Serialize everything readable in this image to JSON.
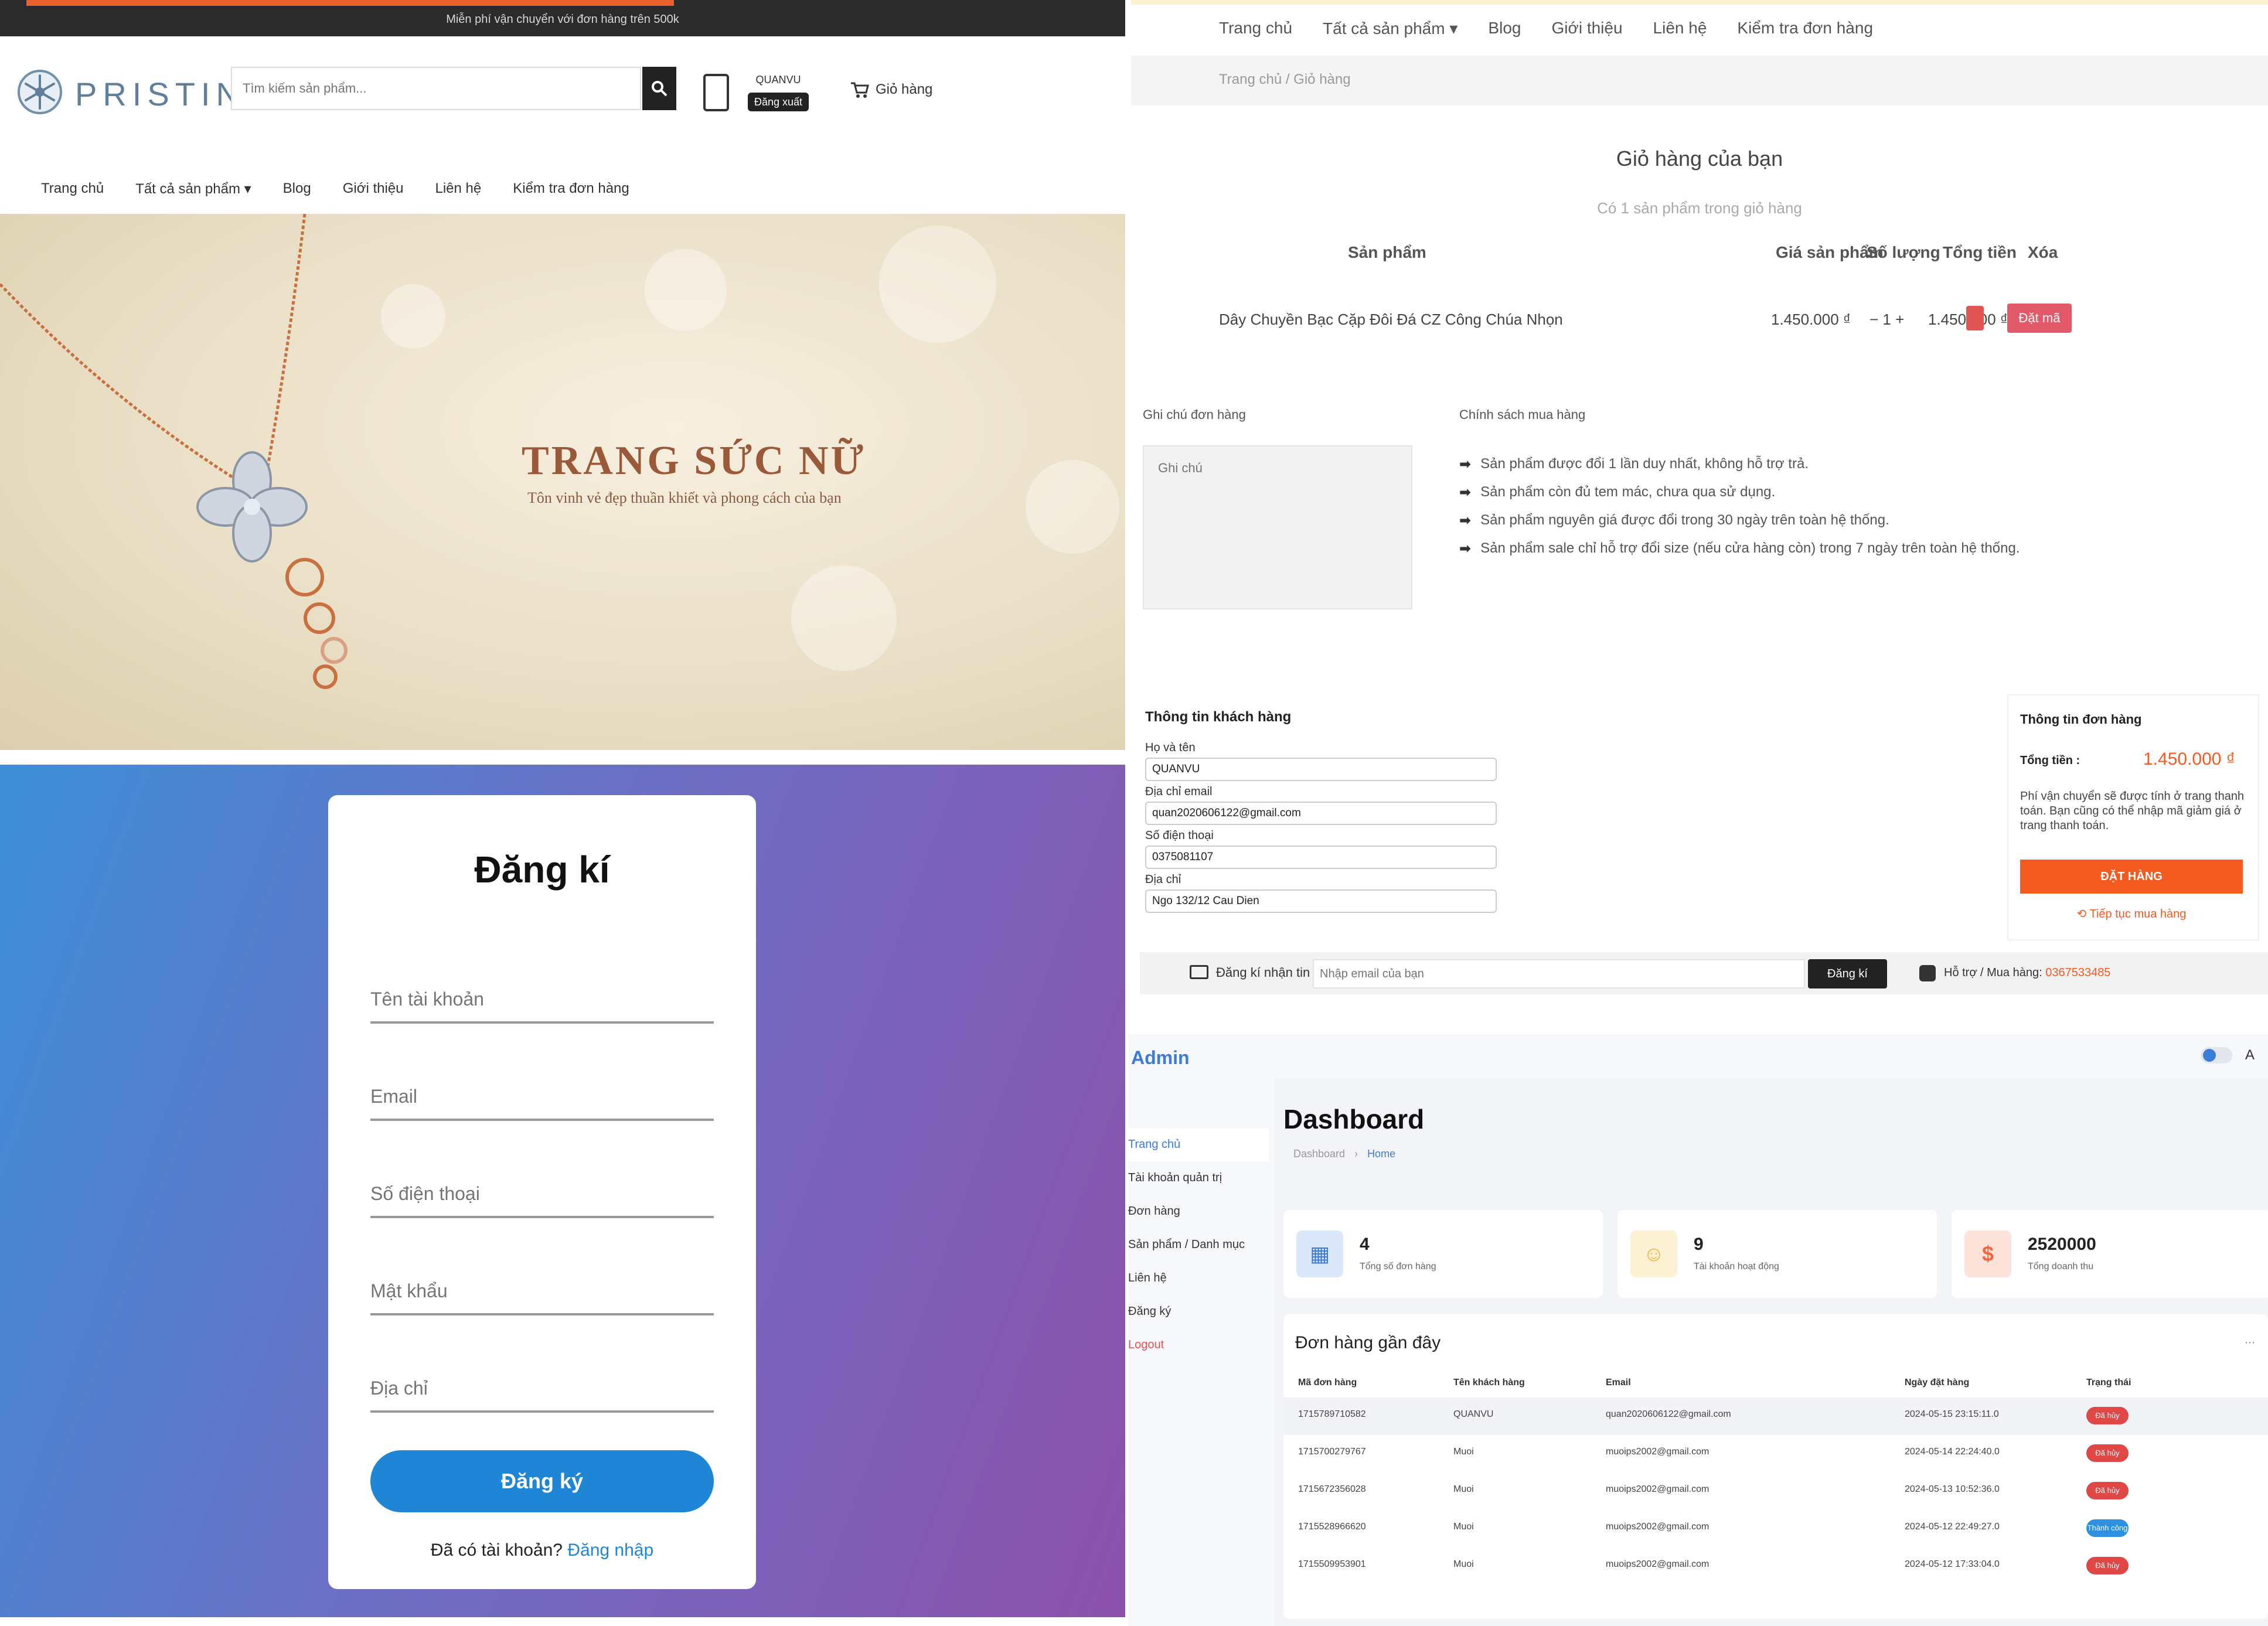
{
  "home": {
    "topbar_text": "Miễn phí vận chuyển với đơn hàng trên 500k",
    "brand": "PRISTINE",
    "search_placeholder": "Tìm kiếm sản phẩm...",
    "user_name": "QUANVU",
    "logout_label": "Đăng xuất",
    "cart_label": "Giỏ hàng",
    "nav": [
      "Trang chủ",
      "Tất cả sản phẩm ▾",
      "Blog",
      "Giới thiệu",
      "Liên hệ",
      "Kiểm tra đơn hàng"
    ],
    "hero_title": "TRANG SỨC NỮ",
    "hero_subtitle": "Tôn vinh vẻ đẹp thuần khiết và phong cách của bạn"
  },
  "register": {
    "title": "Đăng kí",
    "fields": [
      "Tên tài khoản",
      "Email",
      "Số điện thoại",
      "Mật khẩu",
      "Địa chỉ"
    ],
    "submit_label": "Đăng ký",
    "have_account": "Đã có tài khoản?",
    "login_link": "Đăng nhập"
  },
  "cart": {
    "nav": [
      "Trang chủ",
      "Tất cả sản phẩm ▾",
      "Blog",
      "Giới thiệu",
      "Liên hệ",
      "Kiểm tra đơn hàng"
    ],
    "breadcrumb": "Trang chủ / Giỏ hàng",
    "title": "Giỏ hàng của bạn",
    "count_text": "Có 1 sản phẩm trong giỏ hàng",
    "headers": [
      "Sản phẩm",
      "Giá sản phẩm",
      "Số lượng",
      "Tổng tiền",
      "Xóa"
    ],
    "item": {
      "name": "Dây Chuyền Bạc Cặp Đôi Đá CZ Công Chúa Nhọn",
      "price": "1.450.000 ₫",
      "qty": "−  1  +",
      "total": "1.450.000 ₫",
      "status": "Đặt mã"
    },
    "note_label": "Ghi chú đơn hàng",
    "note_placeholder": "Ghi chú",
    "policy_title": "Chính sách mua hàng",
    "policies": [
      "Sản phẩm được đổi 1 lần duy nhất, không hỗ trợ trả.",
      "Sản phẩm còn đủ tem mác, chưa qua sử dụng.",
      "Sản phẩm nguyên giá được đổi trong 30 ngày trên toàn hệ thống.",
      "Sản phẩm sale chỉ hỗ trợ đổi size (nếu cửa hàng còn) trong 7 ngày trên toàn hệ thống."
    ],
    "customer": {
      "title": "Thông tin khách hàng",
      "name_label": "Họ và tên",
      "name_value": "QUANVU",
      "email_label": "Địa chỉ email",
      "email_value": "quan2020606122@gmail.com",
      "phone_label": "Số điện thoại",
      "phone_value": "0375081107",
      "address_label": "Địa chỉ",
      "address_value": "Ngo 132/12 Cau Dien"
    },
    "order": {
      "title": "Thông tin đơn hàng",
      "total_label": "Tổng tiền :",
      "total_value": "1.450.000 ₫",
      "note": "Phí vận chuyển sẽ được tính ở trang thanh toán. Bạn cũng có thể nhập mã giảm giá ở trang thanh toán.",
      "order_button": "ĐẶT HÀNG",
      "continue_link": "⟲ Tiếp tục mua hàng"
    },
    "newsletter": {
      "label": "Đăng kí nhận tin",
      "placeholder": "Nhập email của bạn",
      "button": "Đăng kí",
      "support_label": "Hỗ trợ / Mua hàng:",
      "support_phone": "0367533485"
    }
  },
  "admin": {
    "brand": "Admin",
    "user_initial": "A",
    "sidebar": [
      "Trang chủ",
      "Tài khoản quản trị",
      "Đơn hàng",
      "Sản phẩm / Danh mục",
      "Liên hệ",
      "Đăng ký",
      "Logout"
    ],
    "title": "Dashboard",
    "breadcrumb": [
      "Dashboard",
      "›",
      "Home"
    ],
    "stats": [
      {
        "value": "4",
        "label": "Tổng số đơn hàng",
        "icon": "calendar-check-icon",
        "color": "#3d7bd8",
        "bg": "#dbe8fa"
      },
      {
        "value": "9",
        "label": "Tài khoản hoạt động",
        "icon": "users-icon",
        "color": "#f0b43a",
        "bg": "#fdf1d3"
      },
      {
        "value": "2520000",
        "label": "Tổng doanh thu",
        "icon": "dollar-icon",
        "color": "#f4673e",
        "bg": "#fde2da"
      }
    ],
    "recent_title": "Đơn hàng gần đây",
    "columns": [
      "Mã đơn hàng",
      "Tên khách hàng",
      "Email",
      "Ngày đặt hàng",
      "Trạng thái"
    ],
    "rows": [
      {
        "id": "1715789710582",
        "name": "QUANVU",
        "email": "quan2020606122@gmail.com",
        "date": "2024-05-15 23:15:11.0",
        "status": "Đã hủy",
        "status_color": "#e04848"
      },
      {
        "id": "1715700279767",
        "name": "Muoi",
        "email": "muoips2002@gmail.com",
        "date": "2024-05-14 22:24:40.0",
        "status": "Đã hủy",
        "status_color": "#e04848"
      },
      {
        "id": "1715672356028",
        "name": "Muoi",
        "email": "muoips2002@gmail.com",
        "date": "2024-05-13 10:52:36.0",
        "status": "Đã hủy",
        "status_color": "#e04848"
      },
      {
        "id": "1715528966620",
        "name": "Muoi",
        "email": "muoips2002@gmail.com",
        "date": "2024-05-12 22:49:27.0",
        "status": "Thành công",
        "status_color": "#2f8fe0"
      },
      {
        "id": "1715509953901",
        "name": "Muoi",
        "email": "muoips2002@gmail.com",
        "date": "2024-05-12 17:33:04.0",
        "status": "Đã hủy",
        "status_color": "#e04848"
      }
    ]
  }
}
